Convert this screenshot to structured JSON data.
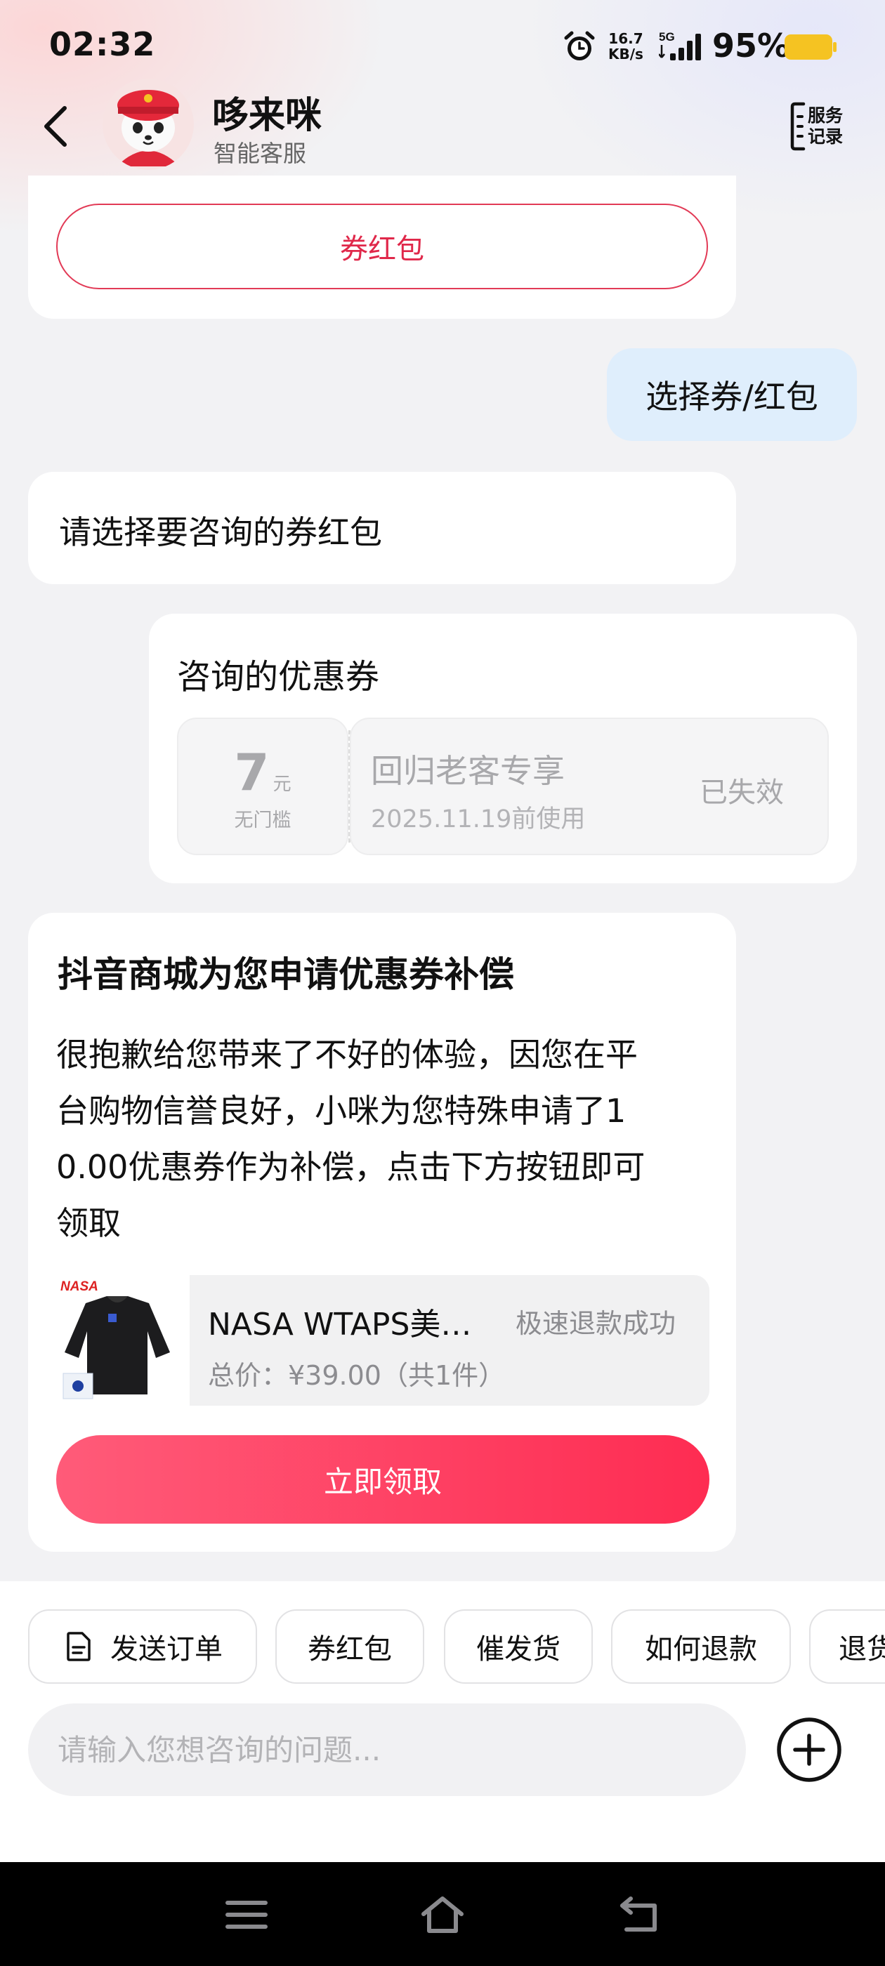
{
  "status_bar": {
    "time": "02:32",
    "net_speed_value": "16.7",
    "net_speed_unit": "KB/s",
    "network_type": "5G",
    "battery": "95%",
    "battery_color": "#f5c322"
  },
  "header": {
    "name": "哆来咪",
    "subtitle": "智能客服",
    "service_record_line1": "服务",
    "service_record_line2": "记录"
  },
  "messages": {
    "prev_card_button": "券红包",
    "user_bubble": "选择券/红包",
    "bot_prompt": "请选择要咨询的券红包",
    "coupon_card": {
      "title": "咨询的优惠券",
      "amount": "7",
      "unit": "元",
      "threshold": "无门槛",
      "name": "回归老客专享",
      "validity": "2025.11.19前使用",
      "status": "已失效"
    },
    "compensation_card": {
      "title": "抖音商城为您申请优惠券补偿",
      "body_line1": "很抱歉给您带来了不好的体验，因您在平",
      "body_line2": "台购物信誉良好，小咪为您特殊申请了1",
      "body_line3": "0.00优惠券作为补偿，点击下方按钮即可",
      "body_line4": "领取",
      "product_brand_tag": "NASA",
      "product_name": "NASA WTAPS美…",
      "refund_status": "极速退款成功",
      "total_price": "总价：¥39.00（共1件）",
      "claim_button": "立即领取"
    }
  },
  "quick_chips": [
    "发送订单",
    "券红包",
    "催发货",
    "如何退款",
    "退货"
  ],
  "input": {
    "placeholder": "请输入您想咨询的问题..."
  },
  "colors": {
    "accent": "#fe2c52",
    "outline_red": "#e23a56",
    "user_bubble": "#dfeefc"
  }
}
